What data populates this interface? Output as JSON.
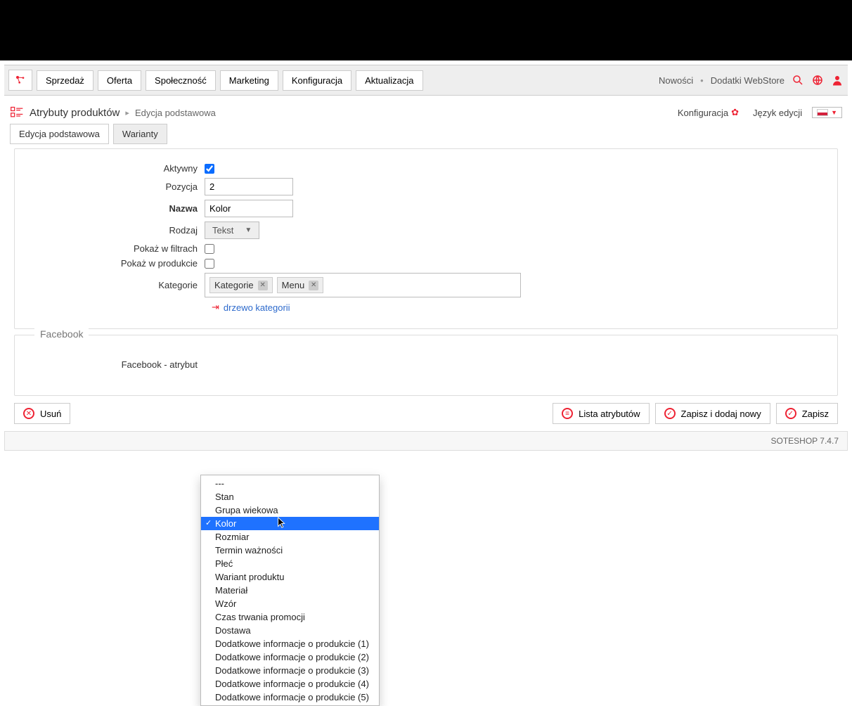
{
  "toolbar": {
    "nav": [
      "Sprzedaż",
      "Oferta",
      "Społeczność",
      "Marketing",
      "Konfiguracja",
      "Aktualizacja"
    ],
    "news": "Nowości",
    "addons": "Dodatki WebStore"
  },
  "subheader": {
    "title": "Atrybuty produktów",
    "sub": "Edycja podstawowa",
    "config": "Konfiguracja",
    "lang_label": "Język edycji"
  },
  "tabs": {
    "basic": "Edycja podstawowa",
    "variants": "Warianty"
  },
  "form": {
    "labels": {
      "active": "Aktywny",
      "position": "Pozycja",
      "name": "Nazwa",
      "type": "Rodzaj",
      "show_filters": "Pokaż w filtrach",
      "show_product": "Pokaż w produkcie",
      "categories": "Kategorie"
    },
    "values": {
      "active": true,
      "position": "2",
      "name": "Kolor",
      "type": "Tekst",
      "show_filters": false,
      "show_product": false,
      "tags": [
        "Kategorie",
        "Menu"
      ]
    },
    "tree_link": "drzewo kategorii"
  },
  "fb": {
    "legend": "Facebook",
    "label": "Facebook - atrybut"
  },
  "actions": {
    "delete": "Usuń",
    "list": "Lista atrybutów",
    "save_new": "Zapisz i dodaj nowy",
    "save": "Zapisz"
  },
  "dropdown": {
    "options": [
      "---",
      "Stan",
      "Grupa wiekowa",
      "Kolor",
      "Rozmiar",
      "Termin ważności",
      "Płeć",
      "Wariant produktu",
      "Materiał",
      "Wzór",
      "Czas trwania promocji",
      "Dostawa",
      "Dodatkowe informacje o produkcie (1)",
      "Dodatkowe informacje o produkcie (2)",
      "Dodatkowe informacje o produkcie (3)",
      "Dodatkowe informacje o produkcie (4)",
      "Dodatkowe informacje o produkcie (5)"
    ],
    "selected": "Kolor"
  },
  "footer": {
    "version": "SOTESHOP 7.4.7"
  }
}
